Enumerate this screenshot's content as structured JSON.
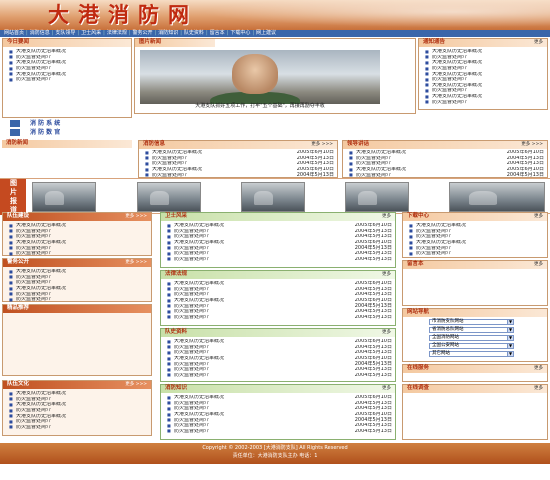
{
  "site_title": "大港消防网",
  "nav": [
    "网站首页",
    "消防信息",
    "支队领导",
    "卫士风采",
    "法律法规",
    "警务公开",
    "消防知识",
    "队史资料",
    "留言本",
    "下载中心",
    "网上建议"
  ],
  "left_top": {
    "title": "今日要闻",
    "items": [
      "大港支队历史沿革概况",
      "防火监督处简介",
      "大港支队历史沿革概况",
      "防火监督处简介",
      "大港支队历史沿革概况",
      "防火监督处简介",
      "大港支队历史沿革概况",
      "防火监督处简介",
      "大港支队历史沿革概况"
    ]
  },
  "left_system": {
    "line1": "消 防 系 统",
    "line2": "消 防 数 官"
  },
  "feature": {
    "title": "图片新闻",
    "caption": "大港支队抓好五项工作，打牢\"五个基础\"，再接再励夺丰收"
  },
  "notice": {
    "title": "通知通告",
    "more": "更多",
    "items": [
      "大港支队历史沿革概况",
      "防火监督处简介",
      "大港支队历史沿革概况",
      "防火监督处简介",
      "大港支队历史沿革概况",
      "防火监督处简介",
      "大港支队历史沿革概况",
      "防火监督处简介",
      "大港支队历史沿革概况",
      "防火监督处简介"
    ]
  },
  "fire_news": {
    "title": "消防新闻"
  },
  "fire_info": {
    "title": "消防信息",
    "more": "更多 >>>",
    "rows": [
      [
        "大港支队历史沿革概况",
        "2005年6月10日"
      ],
      [
        "防火监督处简介",
        "2004年5月13日"
      ],
      [
        "防火监督处简介",
        "2004年5月13日"
      ],
      [
        "大港支队历史沿革概况",
        "2005年6月10日"
      ],
      [
        "防火监督处简介",
        "2004年5月13日"
      ],
      [
        "防火监督处简介",
        "2004年5月13日"
      ],
      [
        "防火监督处简介",
        "2004年5月13日"
      ]
    ]
  },
  "leader_talk": {
    "title": "领导讲话",
    "more": "更多 >>>",
    "rows": [
      [
        "大港支队历史沿革概况",
        "2005年6月10日"
      ],
      [
        "防火监督处简介",
        "2004年5月13日"
      ],
      [
        "防火监督处简介",
        "2004年5月13日"
      ],
      [
        "大港支队历史沿革概况",
        "2005年6月10日"
      ],
      [
        "防火监督处简介",
        "2004年5月13日"
      ],
      [
        "防火监督处简介",
        "2004年5月13日"
      ],
      [
        "防火监督处简介",
        "2004年5月13日"
      ]
    ]
  },
  "photo_tag": "图片报道",
  "mid_boxes": [
    {
      "title": "卫士风采",
      "more": "更多",
      "rows": [
        [
          "大港支队历史沿革概况",
          "2005年6月10日"
        ],
        [
          "防火监督处简介",
          "2004年5月13日"
        ],
        [
          "防火监督处简介",
          "2004年5月13日"
        ],
        [
          "大港支队历史沿革概况",
          "2005年6月10日"
        ],
        [
          "防火监督处简介",
          "2004年5月13日"
        ],
        [
          "防火监督处简介",
          "2004年5月13日"
        ],
        [
          "防火监督处简介",
          "2004年5月13日"
        ],
        [
          "防火监督处简介",
          "2004年5月13日"
        ]
      ]
    },
    {
      "title": "法律法规",
      "more": "更多",
      "rows": [
        [
          "大港支队历史沿革概况",
          "2005年6月10日"
        ],
        [
          "防火监督处简介",
          "2004年5月13日"
        ],
        [
          "防火监督处简介",
          "2004年5月13日"
        ],
        [
          "大港支队历史沿革概况",
          "2005年6月10日"
        ],
        [
          "防火监督处简介",
          "2004年5月13日"
        ],
        [
          "防火监督处简介",
          "2004年5月13日"
        ],
        [
          "防火监督处简介",
          "2004年5月13日"
        ],
        [
          "防火监督处简介",
          "2004年5月13日"
        ]
      ]
    },
    {
      "title": "队史资料",
      "more": "更多",
      "rows": [
        [
          "大港支队历史沿革概况",
          "2005年6月10日"
        ],
        [
          "防火监督处简介",
          "2004年5月13日"
        ],
        [
          "防火监督处简介",
          "2004年5月13日"
        ],
        [
          "大港支队历史沿革概况",
          "2005年6月10日"
        ],
        [
          "防火监督处简介",
          "2004年5月13日"
        ],
        [
          "防火监督处简介",
          "2004年5月13日"
        ],
        [
          "防火监督处简介",
          "2004年5月13日"
        ],
        [
          "防火监督处简介",
          "2004年5月13日"
        ]
      ]
    },
    {
      "title": "消防知识",
      "more": "更多",
      "rows": [
        [
          "大港支队历史沿革概况",
          "2005年6月10日"
        ],
        [
          "防火监督处简介",
          "2004年5月13日"
        ],
        [
          "防火监督处简介",
          "2004年5月13日"
        ],
        [
          "大港支队历史沿革概况",
          "2005年6月10日"
        ],
        [
          "防火监督处简介",
          "2004年5月13日"
        ],
        [
          "防火监督处简介",
          "2004年5月13日"
        ],
        [
          "防火监督处简介",
          "2004年5月13日"
        ],
        [
          "防火监督处简介",
          "2004年5月13日"
        ]
      ]
    }
  ],
  "left_boxes": [
    {
      "title": "队伍建设",
      "more": "更多 >>>",
      "items": [
        "大港支队历史沿革概况",
        "防火监督处简介",
        "防火监督处简介",
        "大港支队历史沿革概况",
        "防火监督处简介",
        "防火监督处简介",
        "防火监督处简介"
      ]
    },
    {
      "title": "警务公开",
      "more": "更多 >>>",
      "items": [
        "大港支队历史沿革概况",
        "防火监督处简介",
        "防火监督处简介",
        "大港支队历史沿革概况",
        "防火监督处简介",
        "防火监督处简介",
        "防火监督处简介"
      ]
    },
    {
      "title": "精品推荐",
      "more": "",
      "items": []
    },
    {
      "title": "队伍文化",
      "more": "更多 >>>",
      "items": [
        "大港支队历史沿革概况",
        "防火监督处简介",
        "大港支队历史沿革概况",
        "防火监督处简介",
        "大港支队历史沿革概况",
        "防火监督处简介",
        "防火监督处简介"
      ]
    }
  ],
  "download": {
    "title": "下载中心",
    "more": "更多",
    "items": [
      "大港支队历史沿革概况",
      "防火监督处简介",
      "防火监督处简介",
      "大港支队历史沿革概况",
      "防火监督处简介",
      "防火监督处简介"
    ]
  },
  "guestbook": {
    "title": "留言本",
    "more": "更多"
  },
  "links": {
    "title": "网站导航",
    "options": [
      "市消防支队网站",
      "省消防总队网站",
      "全国消防网站",
      "全国公安网站",
      "其它网站"
    ]
  },
  "online": {
    "title": "在线服务",
    "more": "更多"
  },
  "survey": {
    "title": "在线调查",
    "more": "更多"
  },
  "footer": {
    "copyright": "Copyright © 2002-2003 [大港消防支队] All Rights Reserved",
    "owner": "责任单位：大港消防支队主办 电话：1"
  }
}
